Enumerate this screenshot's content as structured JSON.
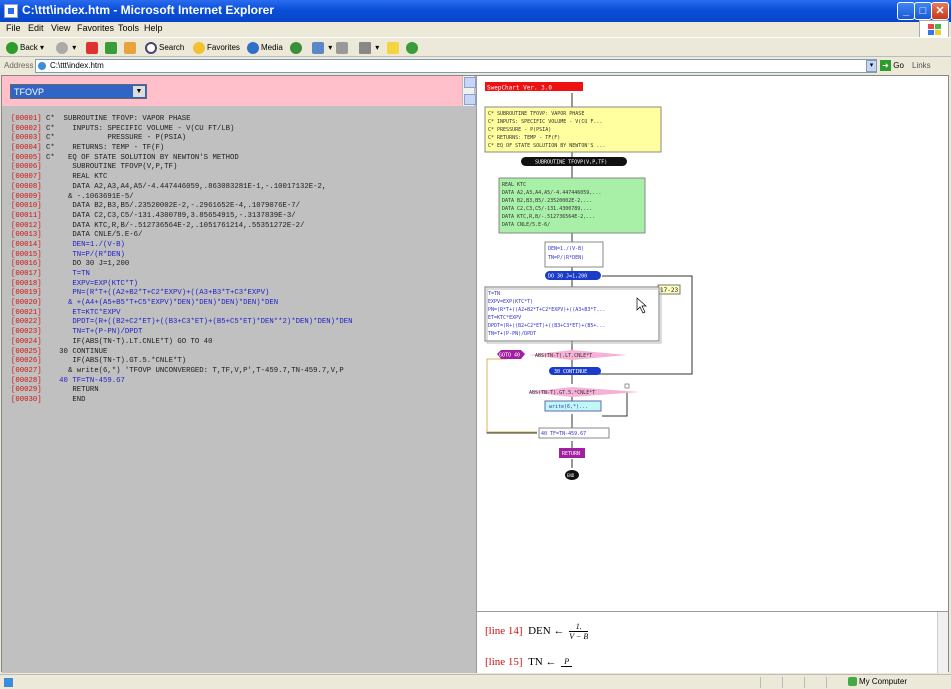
{
  "window": {
    "title": "C:\\ttt\\index.htm - Microsoft Internet Explorer",
    "minimize": "_",
    "maximize": "□",
    "close": "✕"
  },
  "menu": [
    "File",
    "Edit",
    "View",
    "Favorites",
    "Tools",
    "Help"
  ],
  "toolbar": {
    "back": "Back",
    "search": "Search",
    "favorites": "Favorites",
    "media": "Media"
  },
  "address": {
    "label": "Address",
    "url": "C:\\ttt\\index.htm",
    "go": "Go",
    "links": "Links"
  },
  "left": {
    "selected_subroutine": "TFOVP",
    "code_lines": [
      {
        "num": "[00001]",
        "text": "C*  SUBROUTINE TFOVP: VAPOR PHASE",
        "kind": "comment"
      },
      {
        "num": "[00002]",
        "text": "C*    INPUTS: SPECIFIC VOLUME - V(CU FT/LB)",
        "kind": "comment"
      },
      {
        "num": "[00003]",
        "text": "C*            PRESSURE - P(PSIA)",
        "kind": "comment"
      },
      {
        "num": "[00004]",
        "text": "C*    RETURNS: TEMP - TF(F)",
        "kind": "comment"
      },
      {
        "num": "[00005]",
        "text": "C*   EQ OF STATE SOLUTION BY NEWTON'S METHOD",
        "kind": "comment"
      },
      {
        "num": "[00006]",
        "text": "      SUBROUTINE TFOVP(V,P,TF)",
        "kind": "code"
      },
      {
        "num": "[00007]",
        "text": "      REAL KTC",
        "kind": "code"
      },
      {
        "num": "[00008]",
        "text": "      DATA A2,A3,A4,A5/-4.447446059,.863083281E-1,-.10017132E-2,",
        "kind": "code"
      },
      {
        "num": "[00009]",
        "text": "     & -.1063691E-5/",
        "kind": "code"
      },
      {
        "num": "[00010]",
        "text": "      DATA B2,B3,B5/.23520002E-2,-.2961652E-4,.1079076E-7/",
        "kind": "code"
      },
      {
        "num": "[00011]",
        "text": "      DATA C2,C3,C5/-131.4300789,3.85654915,-.3137839E-3/",
        "kind": "code"
      },
      {
        "num": "[00012]",
        "text": "      DATA KTC,R,B/-.512736564E-2,.1051761214,.55351272E-2/",
        "kind": "code"
      },
      {
        "num": "[00013]",
        "text": "      DATA CNLE/5.E-6/",
        "kind": "code"
      },
      {
        "num": "[00014]",
        "text": "      DEN=1./(V-B)",
        "kind": "blue"
      },
      {
        "num": "[00015]",
        "text": "      TN=P/(R*DEN)",
        "kind": "blue"
      },
      {
        "num": "[00016]",
        "text": "      DO 30 J=1,200",
        "kind": "code"
      },
      {
        "num": "[00017]",
        "text": "      T=TN",
        "kind": "blue"
      },
      {
        "num": "[00018]",
        "text": "      EXPV=EXP(KTC*T)",
        "kind": "blue"
      },
      {
        "num": "[00019]",
        "text": "      PN=(R*T+((A2+B2*T+C2*EXPV)+((A3+B3*T+C3*EXPV)",
        "kind": "blue"
      },
      {
        "num": "[00020]",
        "text": "     & +(A4+(A5+B5*T+C5*EXPV)*DEN)*DEN)*DEN)*DEN)*DEN",
        "kind": "blue"
      },
      {
        "num": "[00021]",
        "text": "      ET=KTC*EXPV",
        "kind": "blue"
      },
      {
        "num": "[00022]",
        "text": "      DPDT=(R+((B2+C2*ET)+((B3+C3*ET)+(B5+C5*ET)*DEN**2)*DEN)*DEN)*DEN",
        "kind": "blue"
      },
      {
        "num": "[00023]",
        "text": "      TN=T+(P-PN)/DPDT",
        "kind": "blue"
      },
      {
        "num": "[00024]",
        "text": "      IF(ABS(TN-T).LT.CNLE*T) GO TO 40",
        "kind": "code"
      },
      {
        "num": "[00025]",
        "text": "   30 CONTINUE",
        "kind": "code"
      },
      {
        "num": "[00026]",
        "text": "      IF(ABS(TN-T).GT.5.*CNLE*T)",
        "kind": "code"
      },
      {
        "num": "[00027]",
        "text": "     & write(6,*) 'TFOVP UNCONVERGED: T,TF,V,P',T-459.7,TN-459.7,V,P",
        "kind": "code"
      },
      {
        "num": "[00028]",
        "text": "   40 TF=TN-459.67",
        "kind": "blue"
      },
      {
        "num": "[00029]",
        "text": "      RETURN",
        "kind": "code"
      },
      {
        "num": "[00030]",
        "text": "      END",
        "kind": "code"
      }
    ]
  },
  "flowchart": {
    "banner": "SwepChart Ver. 3.0",
    "comment_lines": [
      "C* SUBROUTINE TFOVP: VAPOR PHASE",
      "C* INPUTS: SPECIFIC VOLUME - V(CU F...",
      "C* PRESSURE - P(PSIA)",
      "C* RETURNS: TEMP - TF(F)",
      "C* EQ OF STATE SOLUTION BY NEWTON'S ..."
    ],
    "subroutine": "SUBROUTINE TFOVP(V,P,TF)",
    "decl_lines": [
      "REAL KTC",
      "DATA A2,A3,A4,A5/-4.447446059,...",
      "DATA B2,B3,B5/.23520002E-2,...",
      "DATA C2,C3,C5/-131.4300789,...",
      "DATA KTC,R,B/-.512736564E-2,...",
      "DATA CNLE/5.E-6/"
    ],
    "assign1": [
      "DEN=1./(V-B)",
      "TN=P/(R*DEN)"
    ],
    "do_loop": "DO 30 J=1,200",
    "range_label": "17-23",
    "loop_body": [
      "T=TN",
      "EXPV=EXP(KTC*T)",
      "PN=(R*T+((A2+B2*T+C2*EXPV)+((A3+B3*T...",
      "ET=KTC*EXPV",
      "DPDT=(R+((B2+C2*ET)+((B3+C3*ET)+(B5+...",
      "TN=T+(P-PN)/DPDT"
    ],
    "goto": "GOTO 40",
    "if_cond1": "ABS(TN-T).LT.CNLE*T",
    "continue": "30 CONTINUE",
    "if_cond2": "ABS(TN-T).GT.5.*CNLE*T",
    "write": "write(6,*)...",
    "assign_tf": "40 TF=TN-459.67",
    "return": "RETURN",
    "end": "END"
  },
  "formula_pane": {
    "row1_label": "[line 14]",
    "row1_var": "DEN",
    "row1_num": "1.",
    "row1_den": "V − B",
    "row2_label": "[line 15]",
    "row2_var": "TN",
    "row2_num": "P"
  },
  "status": {
    "zone": "My Computer"
  }
}
